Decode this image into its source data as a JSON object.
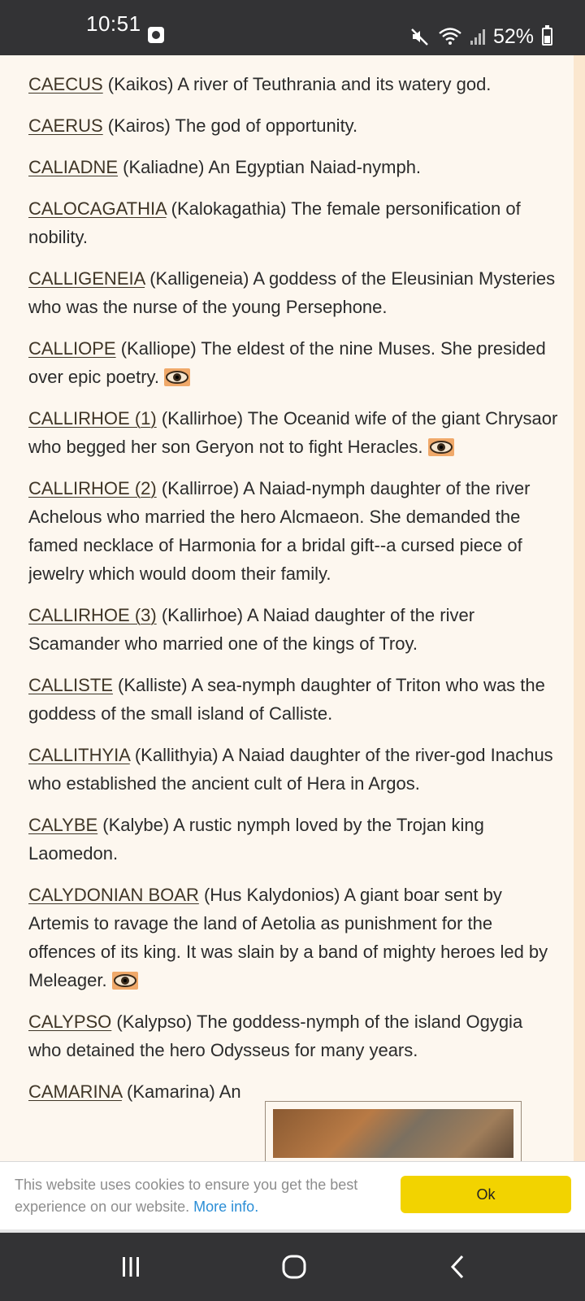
{
  "status_bar": {
    "time": "10:51",
    "battery": "52%",
    "battery_level": 0.52,
    "icons": [
      "screen-record-icon",
      "mute-icon",
      "wifi-icon",
      "signal-icon",
      "battery-icon"
    ]
  },
  "entries": [
    {
      "name": "CAECUS",
      "text": " (Kaikos) A river of Teuthrania and its watery god."
    },
    {
      "name": "CAERUS",
      "text": " (Kairos) The god of opportunity."
    },
    {
      "name": "CALIADNE",
      "text": " (Kaliadne) An Egyptian Naiad-nymph."
    },
    {
      "name": "CALOCAGATHIA",
      "text": " (Kalokagathia) The female personification of nobility."
    },
    {
      "name": "CALLIGENEIA",
      "text": " (Kalligeneia) A goddess of the Eleusinian Mysteries who was the nurse of the young Persephone."
    },
    {
      "name": "CALLIOPE",
      "text": " (Kalliope) The eldest of the nine Muses. She presided over epic poetry.",
      "eye": true
    },
    {
      "name": "CALLIRHOE (1)",
      "text": " (Kallirhoe) The Oceanid wife of the giant Chrysaor who begged her son Geryon not to fight Heracles.",
      "eye": true
    },
    {
      "name": "CALLIRHOE (2)",
      "text": " (Kallirroe) A Naiad-nymph daughter of the river Achelous who married the hero Alcmaeon. She demanded the famed necklace of Harmonia for a bridal gift--a cursed piece of jewelry which would doom their family."
    },
    {
      "name": "CALLIRHOE (3)",
      "text": " (Kallirhoe) A Naiad daughter of the river Scamander who married one of the kings of Troy."
    },
    {
      "name": "CALLISTE",
      "text": " (Kalliste) A sea-nymph daughter of Triton who was the goddess of the small island of Calliste."
    },
    {
      "name": "CALLITHYIA",
      "text": " (Kallithyia) A Naiad daughter of the river-god Inachus who established the ancient cult of Hera in Argos."
    },
    {
      "name": "CALYBE",
      "text": " (Kalybe) A rustic nymph loved by the Trojan king Laomedon."
    },
    {
      "name": "CALYDONIAN BOAR",
      "text": " (Hus Kalydonios) A giant boar sent by Artemis to ravage the land of Aetolia as punishment for the offences of its king. It was slain by a band of mighty heroes led by Meleager.",
      "eye": true
    },
    {
      "name": "CALYPSO",
      "text": " (Kalypso) The goddess-nymph of the island Ogygia who detained the hero Odysseus for many years."
    },
    {
      "name": "CAMARINA",
      "text": " (Kamarina) An"
    }
  ],
  "cookie": {
    "text": "This website uses cookies to ensure you get the best experience on our website.",
    "link": "More info.",
    "ok": "Ok"
  },
  "nav": {
    "icons": [
      "recent-apps-icon",
      "home-icon",
      "back-icon"
    ]
  }
}
